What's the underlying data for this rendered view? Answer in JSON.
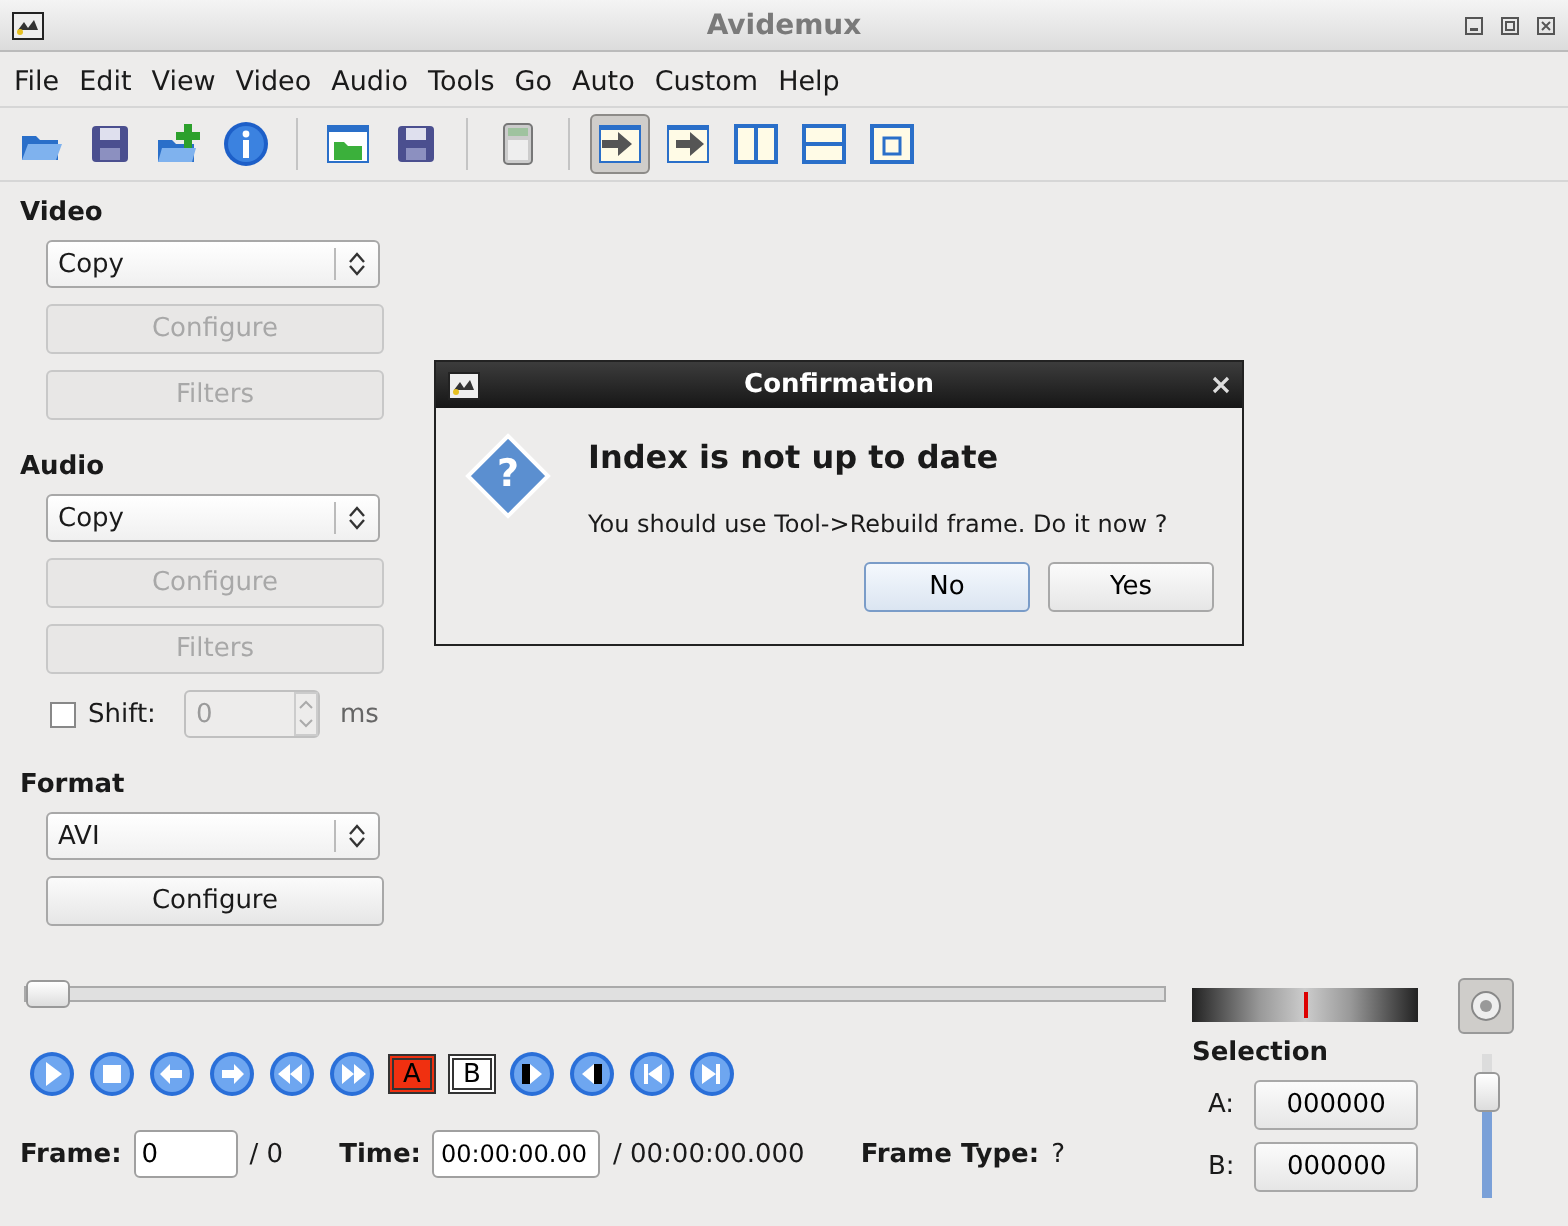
{
  "window": {
    "title": "Avidemux"
  },
  "menu": [
    "File",
    "Edit",
    "View",
    "Video",
    "Audio",
    "Tools",
    "Go",
    "Auto",
    "Custom",
    "Help"
  ],
  "toolbar": [
    {
      "kind": "open",
      "selected": false
    },
    {
      "kind": "save",
      "selected": false
    },
    {
      "kind": "append",
      "selected": false
    },
    {
      "kind": "info",
      "selected": false
    },
    {
      "kind": "sep"
    },
    {
      "kind": "folder",
      "selected": false
    },
    {
      "kind": "save",
      "selected": false
    },
    {
      "kind": "sep"
    },
    {
      "kind": "calc",
      "selected": false
    },
    {
      "kind": "sep"
    },
    {
      "kind": "viewin",
      "selected": true
    },
    {
      "kind": "viewout",
      "selected": false
    },
    {
      "kind": "split-v",
      "selected": false
    },
    {
      "kind": "split-h",
      "selected": false
    },
    {
      "kind": "small",
      "selected": false
    }
  ],
  "video": {
    "heading": "Video",
    "codec": "Copy",
    "configure": {
      "label": "Configure",
      "disabled": true
    },
    "filters": {
      "label": "Filters",
      "disabled": true
    }
  },
  "audio": {
    "heading": "Audio",
    "codec": "Copy",
    "configure": {
      "label": "Configure",
      "disabled": true
    },
    "filters": {
      "label": "Filters",
      "disabled": true
    },
    "shift": {
      "label": "Shift:",
      "checked": false,
      "value": "0",
      "unit": "ms"
    }
  },
  "format": {
    "heading": "Format",
    "container": "AVI",
    "configure": {
      "label": "Configure",
      "disabled": false
    }
  },
  "seek": {
    "level": 0.0
  },
  "controls": [
    {
      "kind": "play"
    },
    {
      "kind": "stop"
    },
    {
      "kind": "prev"
    },
    {
      "kind": "next"
    },
    {
      "kind": "rew"
    },
    {
      "kind": "ff"
    },
    {
      "kind": "marker",
      "text": "A"
    },
    {
      "kind": "marker",
      "text": "B"
    },
    {
      "kind": "startkey"
    },
    {
      "kind": "endkey"
    },
    {
      "kind": "first"
    },
    {
      "kind": "last"
    }
  ],
  "frame": {
    "label": "Frame:",
    "value": "0",
    "total": "/ 0"
  },
  "time": {
    "label": "Time:",
    "value": "00:00:00.00",
    "total": "/ 00:00:00.000"
  },
  "frame_type": {
    "label": "Frame Type:",
    "value": "?"
  },
  "selection": {
    "heading": "Selection",
    "a_label": "A:",
    "a": "000000",
    "b_label": "B:",
    "b": "000000"
  },
  "volume": {
    "level": 0.85
  },
  "dialog": {
    "title": "Confirmation",
    "icon_text": "?",
    "heading": "Index is not up to date",
    "message": "You should use Tool->Rebuild frame. Do it now ?",
    "buttons": [
      {
        "label": "No",
        "selected": true
      },
      {
        "label": "Yes",
        "selected": false
      }
    ]
  }
}
